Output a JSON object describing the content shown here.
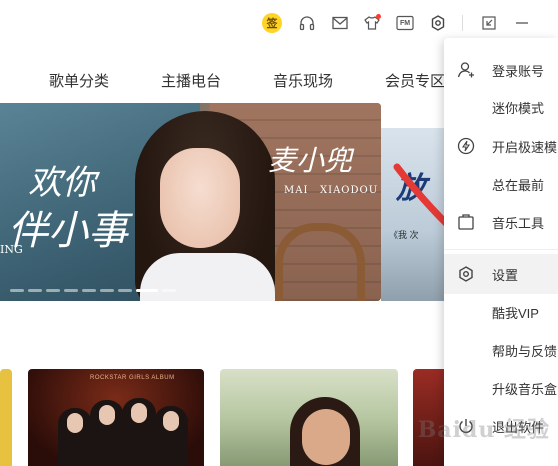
{
  "titlebar": {
    "sign_badge_label": "签",
    "icons": [
      "sign-in-badge",
      "headphones-icon",
      "mail-icon",
      "shirt-icon",
      "fm-icon",
      "settings-gear-icon",
      "mini-mode-icon",
      "minimize-icon"
    ],
    "fm_label": "FM"
  },
  "nav": {
    "items": [
      "歌单分类",
      "主播电台",
      "音乐现场",
      "会员专区"
    ]
  },
  "banner": {
    "artist_name_script": "麦小兜",
    "artist_name_latin_1": "MAI",
    "artist_name_latin_2": "XIAODOU",
    "song_title_line1": "欢你",
    "song_title_line2": "伴小事",
    "song_tag": "ING",
    "next_banner_text": "放",
    "next_banner_subtext": "《我 次"
  },
  "playlist_cards": {
    "card2_top_text": "ROCKSTAR GIRLS ALBUM"
  },
  "menu": {
    "items": [
      {
        "label": "登录账号",
        "icon": "user-icon"
      },
      {
        "label": "迷你模式",
        "icon": ""
      },
      {
        "label": "开启极速模",
        "icon": "lightning-icon"
      },
      {
        "label": "总在最前",
        "icon": ""
      },
      {
        "label": "音乐工具",
        "icon": "toolbox-icon"
      },
      {
        "label": "设置",
        "icon": "settings-icon"
      },
      {
        "label": "酷我VIP",
        "icon": ""
      },
      {
        "label": "帮助与反馈",
        "icon": ""
      },
      {
        "label": "升级音乐盒",
        "icon": ""
      },
      {
        "label": "退出软件",
        "icon": "power-icon"
      }
    ]
  },
  "colors": {
    "accent_red": "#e53935",
    "sign_badge": "#ffd426"
  },
  "watermark_text": "Baidu 经验"
}
